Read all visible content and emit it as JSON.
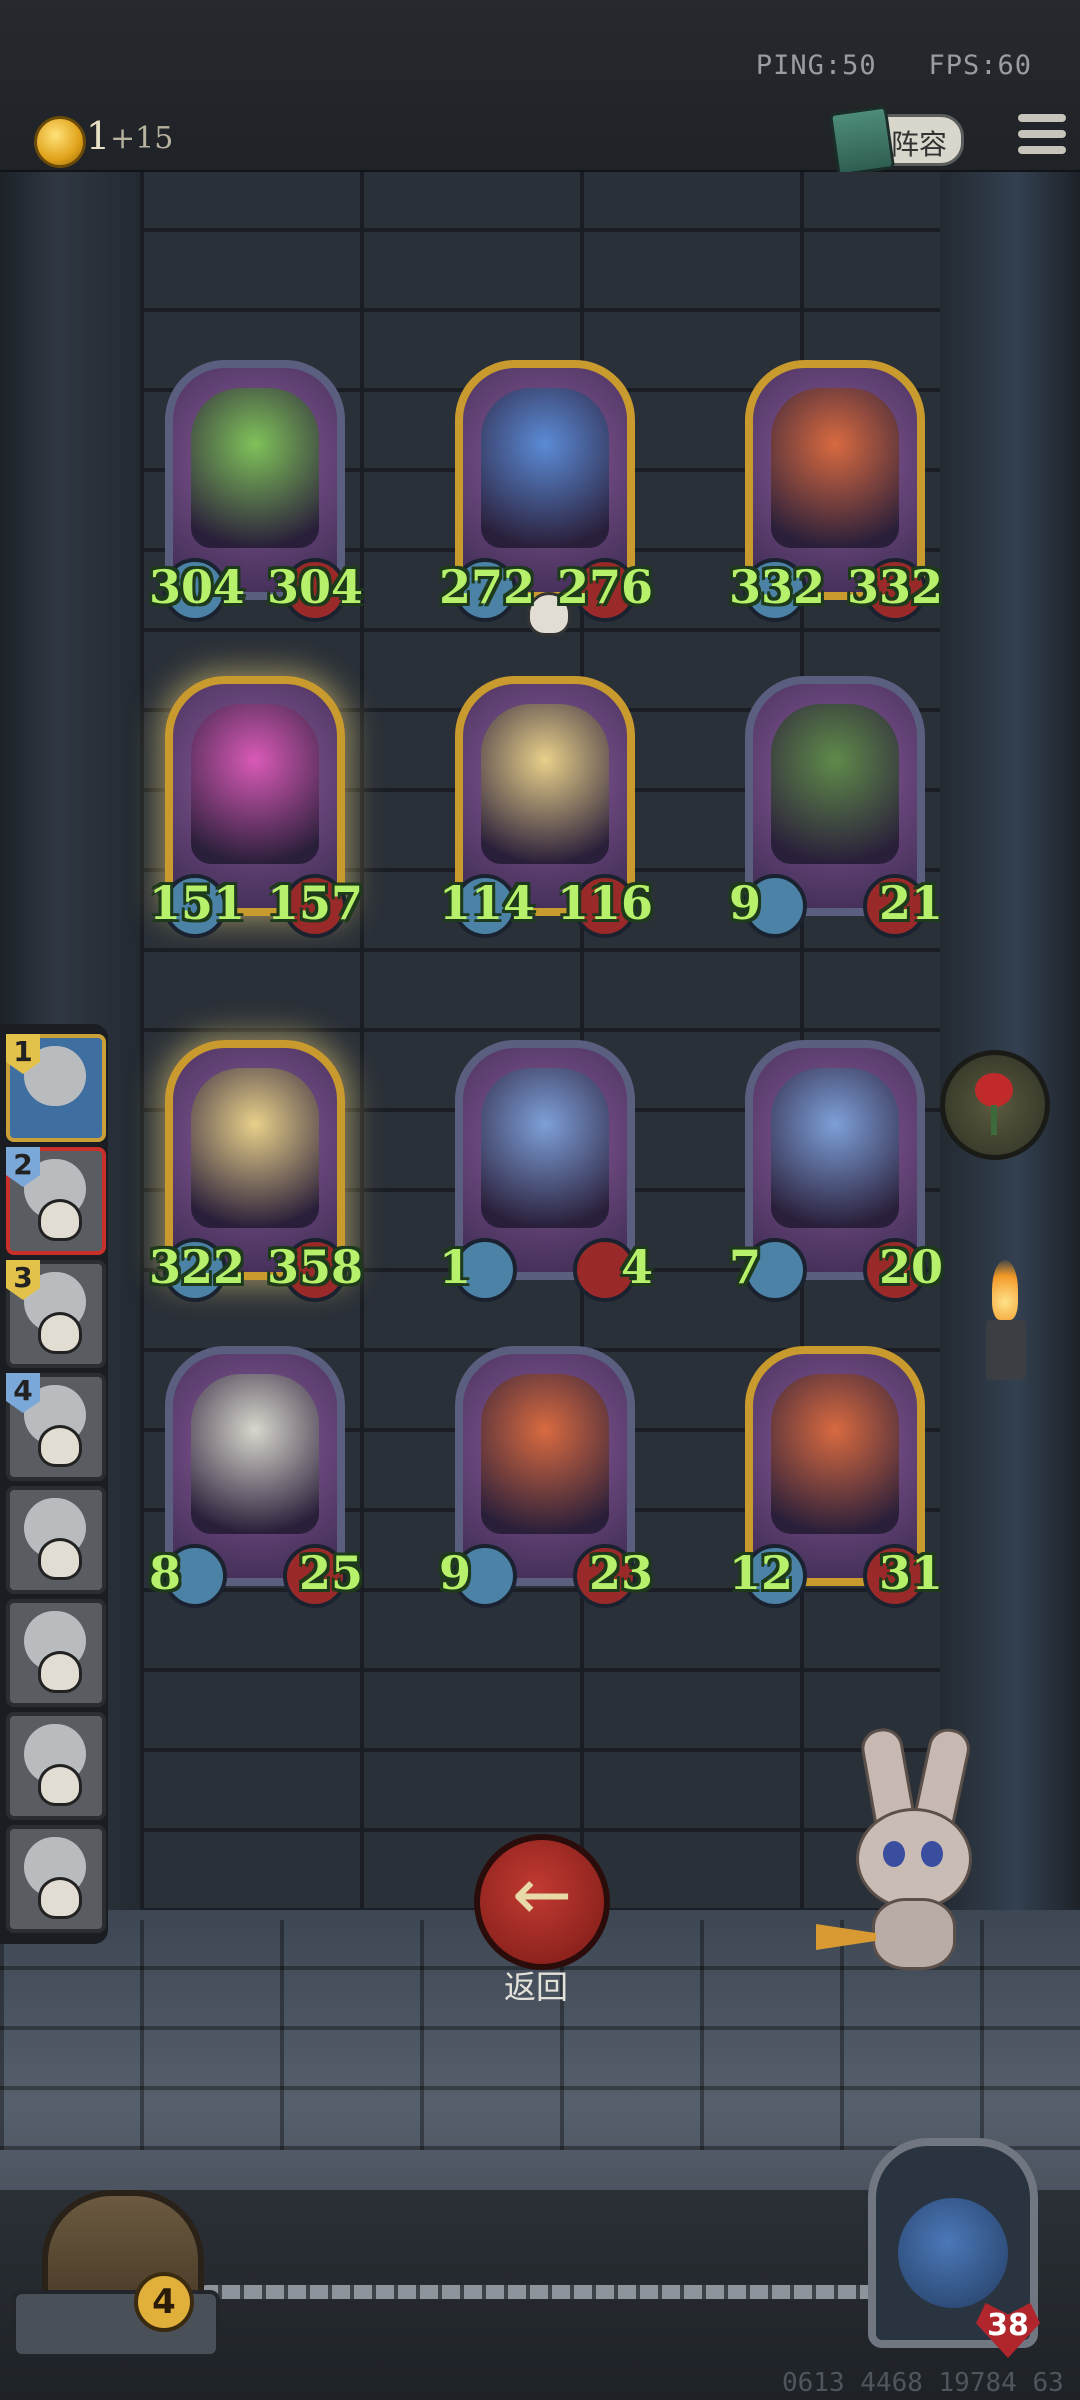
{
  "status": {
    "ping_label": "PING:50",
    "fps_label": "FPS:60"
  },
  "currency": {
    "count": "1",
    "increment": "+15"
  },
  "header": {
    "lineup_label": "阵容"
  },
  "board": {
    "cards": [
      {
        "attack": "304",
        "health": "304",
        "frame": "purple",
        "portrait_color": "#7fc25a"
      },
      {
        "attack": "272",
        "health": "276",
        "frame": "gold",
        "portrait_color": "#5b8bd6",
        "has_skull": true
      },
      {
        "attack": "332",
        "health": "332",
        "frame": "gold",
        "portrait_color": "#d86a40"
      },
      {
        "attack": "151",
        "health": "157",
        "frame": "gold",
        "portrait_color": "#d95ab7",
        "glow": true
      },
      {
        "attack": "114",
        "health": "116",
        "frame": "gold",
        "portrait_color": "#e8d08a"
      },
      {
        "attack": "9",
        "health": "21",
        "frame": "purple",
        "portrait_color": "#5f8a4a"
      },
      {
        "attack": "322",
        "health": "358",
        "frame": "gold",
        "portrait_color": "#e8d08a",
        "glow": true
      },
      {
        "attack": "1",
        "health": "4",
        "frame": "purple",
        "portrait_color": "#7d9fd8"
      },
      {
        "attack": "7",
        "health": "20",
        "frame": "purple",
        "portrait_color": "#7d9fd8"
      },
      {
        "attack": "8",
        "health": "25",
        "frame": "purple",
        "portrait_color": "#d8d6cc"
      },
      {
        "attack": "9",
        "health": "23",
        "frame": "purple",
        "portrait_color": "#d86a40"
      },
      {
        "attack": "12",
        "health": "31",
        "frame": "gold",
        "portrait_color": "#d86a40"
      }
    ]
  },
  "opponents": {
    "slots": [
      {
        "number": "1",
        "state": "active"
      },
      {
        "number": "2",
        "state": "selected-dead"
      },
      {
        "number": "3",
        "state": "dead"
      },
      {
        "number": "4",
        "state": "dead"
      },
      {
        "number": "",
        "state": "dead"
      },
      {
        "number": "",
        "state": "dead"
      },
      {
        "number": "",
        "state": "dead"
      },
      {
        "number": "",
        "state": "dead"
      }
    ]
  },
  "actions": {
    "back_label": "返回"
  },
  "footer": {
    "gate_count": "4",
    "boss_health": "38",
    "user_id": "0613 4468 19784 63"
  },
  "colors": {
    "stat_text": "#b7f06a",
    "gold_frame": "#c99a2e",
    "purple_frame": "#5a5f80",
    "back_button": "#c23a32"
  }
}
